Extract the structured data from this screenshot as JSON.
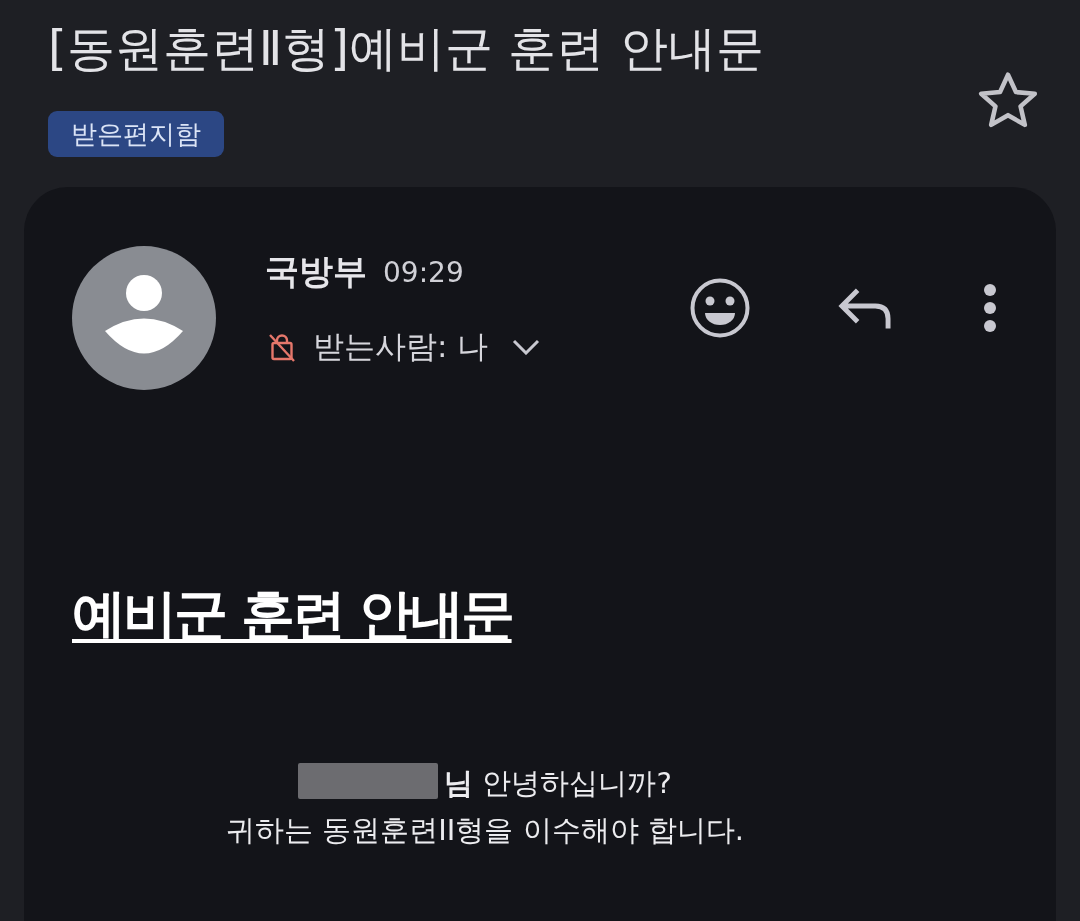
{
  "header": {
    "subject": "[동원훈련Ⅱ형]예비군 훈련 안내문",
    "starred": false,
    "label": "받은편지함"
  },
  "message": {
    "sender": "국방부",
    "time": "09:29",
    "recipient": "받는사람: 나"
  },
  "body": {
    "heading": "예비군 훈련 안내문",
    "lines": [
      {
        "redacted": true,
        "text": "**님** 안녕하십니까?"
      },
      {
        "redacted": false,
        "text": "귀하는 동원훈련II형을 이수해야 합니다."
      }
    ]
  }
}
